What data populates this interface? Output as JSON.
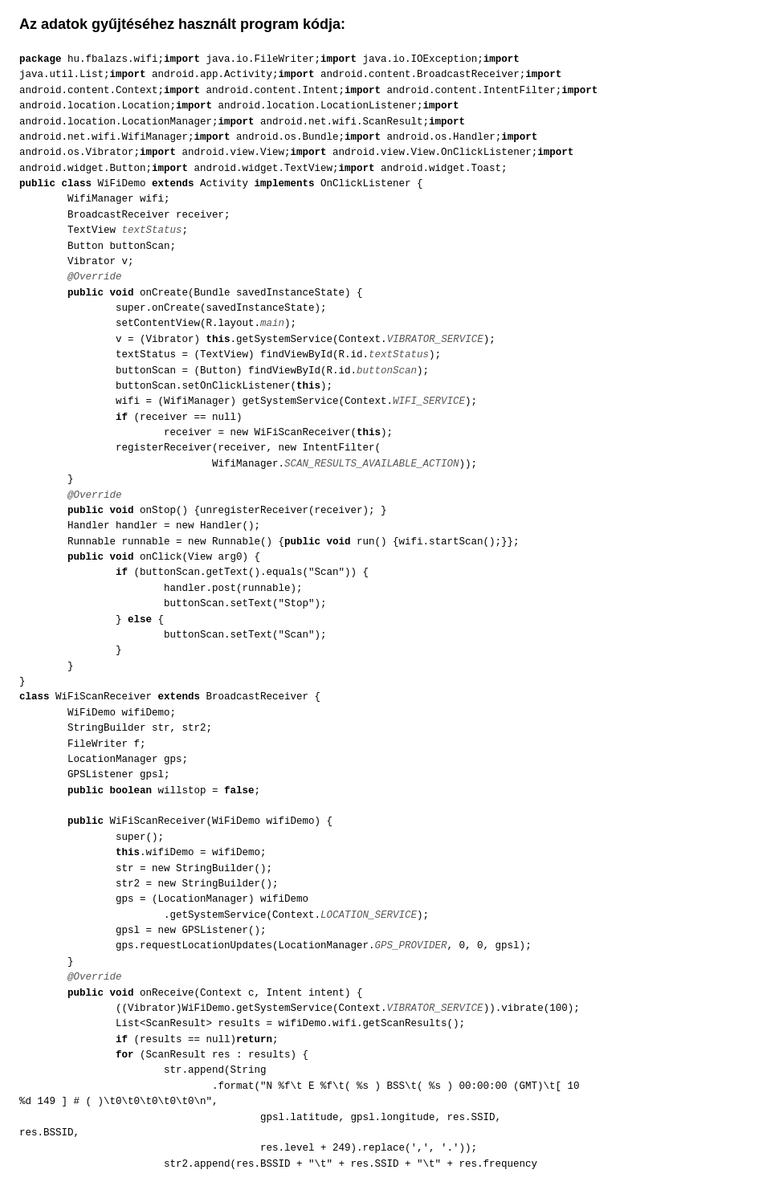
{
  "page": {
    "title": "Az adatok gyűjtéséhez használt program kódja:"
  }
}
